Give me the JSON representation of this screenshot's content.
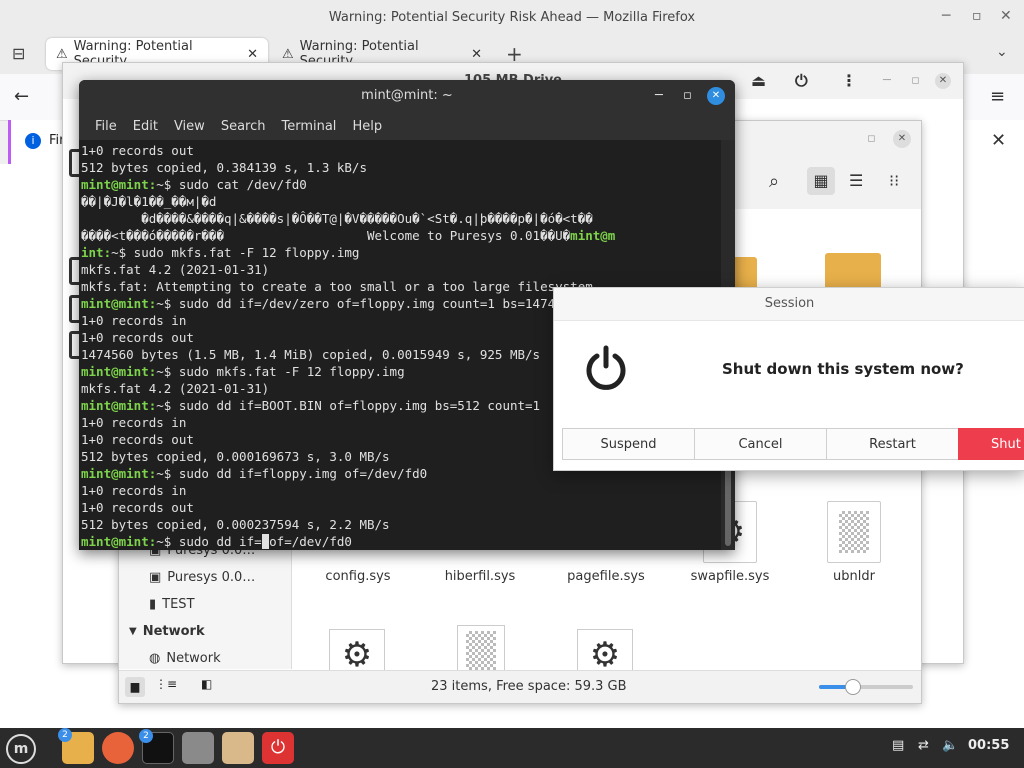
{
  "firefox": {
    "window_title": "Warning: Potential Security Risk Ahead — Mozilla Firefox",
    "tabs": [
      {
        "label": "Warning: Potential Security"
      },
      {
        "label": "Warning: Potential Security"
      }
    ],
    "notif_text": "Fir"
  },
  "nemo": {
    "title": "105 MB Drive",
    "sidebar": {
      "items_top": [
        {
          "label": "Puresys 0.0…"
        },
        {
          "label": "Puresys 0.0…"
        },
        {
          "label": "TEST"
        }
      ],
      "network_heading": "Network",
      "network_item": "Network"
    },
    "files": [
      {
        "name": "config.sys"
      },
      {
        "name": "hiberfil.sys"
      },
      {
        "name": "pagefile.sys"
      },
      {
        "name": "swapfile.sys"
      },
      {
        "name": "ubnldr"
      }
    ],
    "status": "23 items, Free space: 59.3 GB",
    "zoom_level": 0.35
  },
  "terminal": {
    "title": "mint@mint: ~",
    "menu": [
      "File",
      "Edit",
      "View",
      "Search",
      "Terminal",
      "Help"
    ],
    "lines": [
      {
        "text": "1+0 records out"
      },
      {
        "text": "512 bytes copied, 0.384139 s, 1.3 kB/s"
      },
      {
        "prompt": "mint@mint:",
        "text": "~$ sudo cat /dev/fd0"
      },
      {
        "text": "��|�J�l�1��_��м|�d"
      },
      {
        "text": "        �d����&����q|&����s|�Ô��T@|�V�����Ou�`<St�.q|þ����p�|�ó�<t��"
      },
      {
        "text": "����<t���ó�����r���                   Welcome to Puresys 0.01��U�",
        "tail_prompt": "mint@m"
      },
      {
        "prompt": "int:",
        "text": "~$ sudo mkfs.fat -F 12 floppy.img"
      },
      {
        "text": "mkfs.fat 4.2 (2021-01-31)"
      },
      {
        "text": "mkfs.fat: Attempting to create a too small or a too large filesystem"
      },
      {
        "prompt": "mint@mint:",
        "text": "~$ sudo dd if=/dev/zero of=floppy.img count=1 bs=1474560"
      },
      {
        "text": "1+0 records in"
      },
      {
        "text": "1+0 records out"
      },
      {
        "text": "1474560 bytes (1.5 MB, 1.4 MiB) copied, 0.0015949 s, 925 MB/s"
      },
      {
        "prompt": "mint@mint:",
        "text": "~$ sudo mkfs.fat -F 12 floppy.img"
      },
      {
        "text": "mkfs.fat 4.2 (2021-01-31)"
      },
      {
        "prompt": "mint@mint:",
        "text": "~$ sudo dd if=BOOT.BIN of=floppy.img bs=512 count=1"
      },
      {
        "text": "1+0 records in"
      },
      {
        "text": "1+0 records out"
      },
      {
        "text": "512 bytes copied, 0.000169673 s, 3.0 MB/s"
      },
      {
        "prompt": "mint@mint:",
        "text": "~$ sudo dd if=floppy.img of=/dev/fd0"
      },
      {
        "text": "1+0 records in"
      },
      {
        "text": "1+0 records out"
      },
      {
        "text": "512 bytes copied, 0.000237594 s, 2.2 MB/s"
      }
    ],
    "current_prompt": "mint@mint:",
    "current_cmd_before": "~$ sudo dd if=",
    "current_cmd_after": "of=/dev/fd0"
  },
  "session": {
    "title": "Session",
    "message": "Shut down this system now?",
    "buttons": {
      "suspend": "Suspend",
      "cancel": "Cancel",
      "restart": "Restart",
      "shutdown": "Shut"
    }
  },
  "taskbar": {
    "files_badge": "2",
    "terminal_badge": "2",
    "clock": "00:55"
  }
}
